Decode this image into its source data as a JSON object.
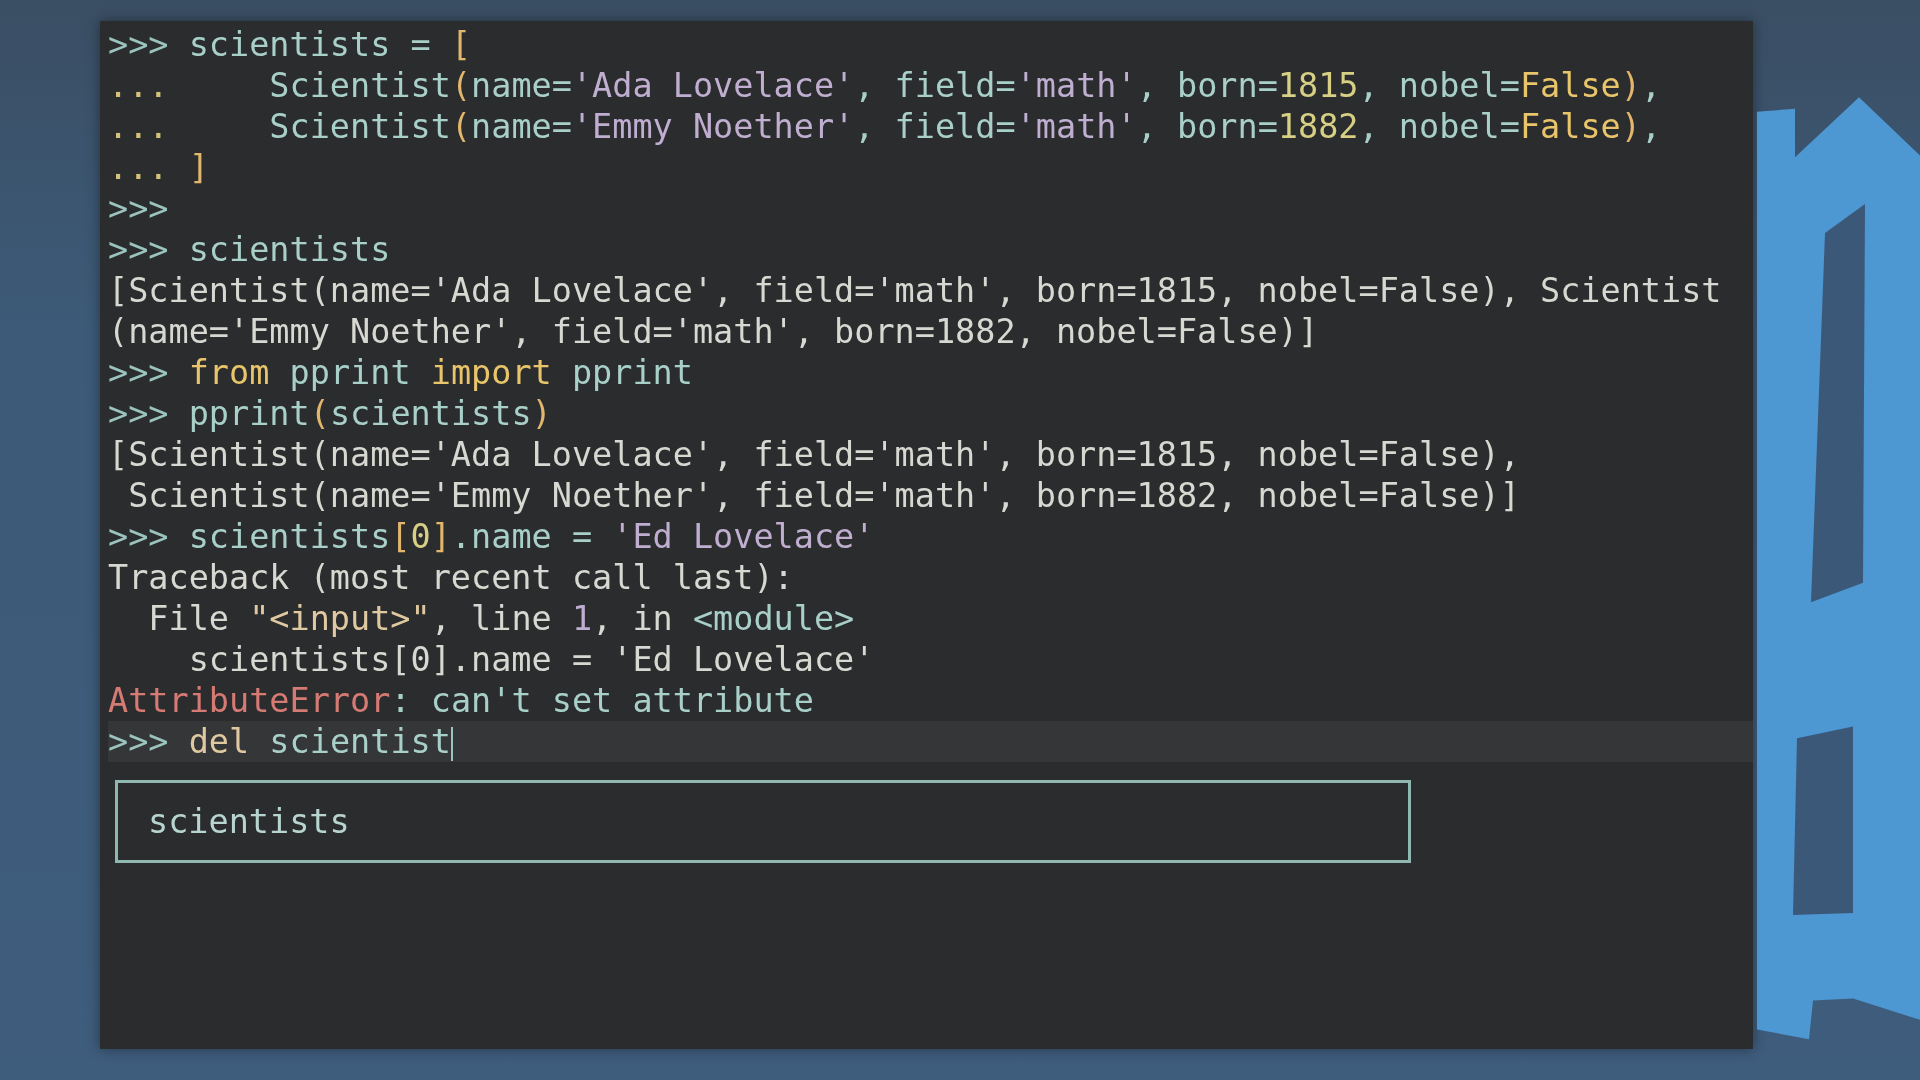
{
  "terminal": {
    "lines": [
      {
        "current": false,
        "tokens": [
          {
            "text": ">>> ",
            "kind": "prompt"
          },
          {
            "text": "scientists = ",
            "kind": "name"
          },
          {
            "text": "[",
            "kind": "bracket"
          }
        ]
      },
      {
        "current": false,
        "tokens": [
          {
            "text": "...     ",
            "kind": "continuation"
          },
          {
            "text": "Scientist",
            "kind": "name"
          },
          {
            "text": "(",
            "kind": "bracket"
          },
          {
            "text": "name=",
            "kind": "name"
          },
          {
            "text": "'Ada Lovelace'",
            "kind": "string"
          },
          {
            "text": ", field=",
            "kind": "name"
          },
          {
            "text": "'math'",
            "kind": "string"
          },
          {
            "text": ", born=",
            "kind": "name"
          },
          {
            "text": "1815",
            "kind": "number"
          },
          {
            "text": ", nobel=",
            "kind": "name"
          },
          {
            "text": "False",
            "kind": "keyword"
          },
          {
            "text": ")",
            "kind": "bracket"
          },
          {
            "text": ",",
            "kind": "name"
          }
        ]
      },
      {
        "current": false,
        "tokens": [
          {
            "text": "...     ",
            "kind": "continuation"
          },
          {
            "text": "Scientist",
            "kind": "name"
          },
          {
            "text": "(",
            "kind": "bracket"
          },
          {
            "text": "name=",
            "kind": "name"
          },
          {
            "text": "'Emmy Noether'",
            "kind": "string"
          },
          {
            "text": ", field=",
            "kind": "name"
          },
          {
            "text": "'math'",
            "kind": "string"
          },
          {
            "text": ", born=",
            "kind": "name"
          },
          {
            "text": "1882",
            "kind": "number"
          },
          {
            "text": ", nobel=",
            "kind": "name"
          },
          {
            "text": "False",
            "kind": "keyword"
          },
          {
            "text": ")",
            "kind": "bracket"
          },
          {
            "text": ",",
            "kind": "name"
          }
        ]
      },
      {
        "current": false,
        "tokens": [
          {
            "text": "... ",
            "kind": "continuation"
          },
          {
            "text": "]",
            "kind": "bracket"
          }
        ]
      },
      {
        "current": false,
        "tokens": [
          {
            "text": ">>>",
            "kind": "prompt"
          }
        ]
      },
      {
        "current": false,
        "tokens": [
          {
            "text": ">>> ",
            "kind": "prompt"
          },
          {
            "text": "scientists",
            "kind": "name"
          }
        ]
      },
      {
        "current": false,
        "tokens": [
          {
            "text": "[Scientist(name='Ada Lovelace', field='math', born=1815, nobel=False), Scientist",
            "kind": "output"
          }
        ]
      },
      {
        "current": false,
        "tokens": [
          {
            "text": "(name='Emmy Noether', field='math', born=1882, nobel=False)]",
            "kind": "output"
          }
        ]
      },
      {
        "current": false,
        "tokens": [
          {
            "text": ">>> ",
            "kind": "prompt"
          },
          {
            "text": "from",
            "kind": "keyword"
          },
          {
            "text": " pprint ",
            "kind": "name"
          },
          {
            "text": "import",
            "kind": "keyword"
          },
          {
            "text": " pprint",
            "kind": "name"
          }
        ]
      },
      {
        "current": false,
        "tokens": [
          {
            "text": ">>> ",
            "kind": "prompt"
          },
          {
            "text": "pprint",
            "kind": "name"
          },
          {
            "text": "(",
            "kind": "bracket"
          },
          {
            "text": "scientists",
            "kind": "name"
          },
          {
            "text": ")",
            "kind": "bracket"
          }
        ]
      },
      {
        "current": false,
        "tokens": [
          {
            "text": "[Scientist(name='Ada Lovelace', field='math', born=1815, nobel=False),",
            "kind": "output"
          }
        ]
      },
      {
        "current": false,
        "tokens": [
          {
            "text": " Scientist(name='Emmy Noether', field='math', born=1882, nobel=False)]",
            "kind": "output"
          }
        ]
      },
      {
        "current": false,
        "tokens": [
          {
            "text": ">>> ",
            "kind": "prompt"
          },
          {
            "text": "scientists",
            "kind": "name"
          },
          {
            "text": "[",
            "kind": "bracket"
          },
          {
            "text": "0",
            "kind": "number"
          },
          {
            "text": "]",
            "kind": "bracket"
          },
          {
            "text": ".name = ",
            "kind": "name"
          },
          {
            "text": "'Ed Lovelace'",
            "kind": "string"
          }
        ]
      },
      {
        "current": false,
        "tokens": [
          {
            "text": "Traceback (most recent call last):",
            "kind": "output"
          }
        ]
      },
      {
        "current": false,
        "tokens": [
          {
            "text": "  File ",
            "kind": "output"
          },
          {
            "text": "\"<input>\"",
            "kind": "filename"
          },
          {
            "text": ", line ",
            "kind": "output"
          },
          {
            "text": "1",
            "kind": "string"
          },
          {
            "text": ", in ",
            "kind": "output"
          },
          {
            "text": "<module>",
            "kind": "name"
          }
        ]
      },
      {
        "current": false,
        "tokens": [
          {
            "text": "    scientists[0].name = 'Ed Lovelace'",
            "kind": "output"
          }
        ]
      },
      {
        "current": false,
        "tokens": [
          {
            "text": "AttributeError",
            "kind": "error"
          },
          {
            "text": ": can't set attribute",
            "kind": "name"
          }
        ]
      },
      {
        "current": true,
        "tokens": [
          {
            "text": ">>> ",
            "kind": "prompt"
          },
          {
            "text": "del",
            "kind": "filename"
          },
          {
            "text": " scientist",
            "kind": "name"
          }
        ]
      }
    ],
    "completions": [
      "scientists"
    ]
  }
}
